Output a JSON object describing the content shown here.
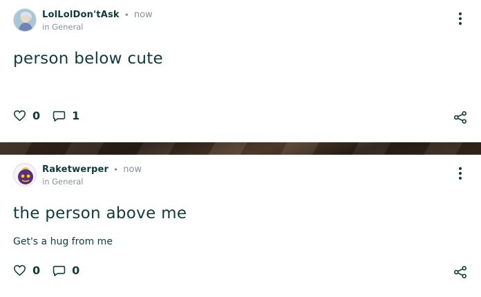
{
  "posts": [
    {
      "author": "LolLolDon'tAsk",
      "separator": "•",
      "time": "now",
      "location": "in General",
      "title": "person below cute",
      "body": "",
      "likes": "0",
      "comments": "1"
    },
    {
      "author": "Raketwerper",
      "separator": "•",
      "time": "now",
      "location": "in General",
      "title": "the person above me",
      "body": "Get's a hug from me",
      "likes": "0",
      "comments": "0"
    }
  ],
  "icons": {
    "like": "heart-icon",
    "comment": "speech-bubble-icon",
    "share": "share-icon",
    "menu": "kebab-menu-icon"
  },
  "colors": {
    "text": "#0f3b3a",
    "muted": "#8a8f99"
  }
}
